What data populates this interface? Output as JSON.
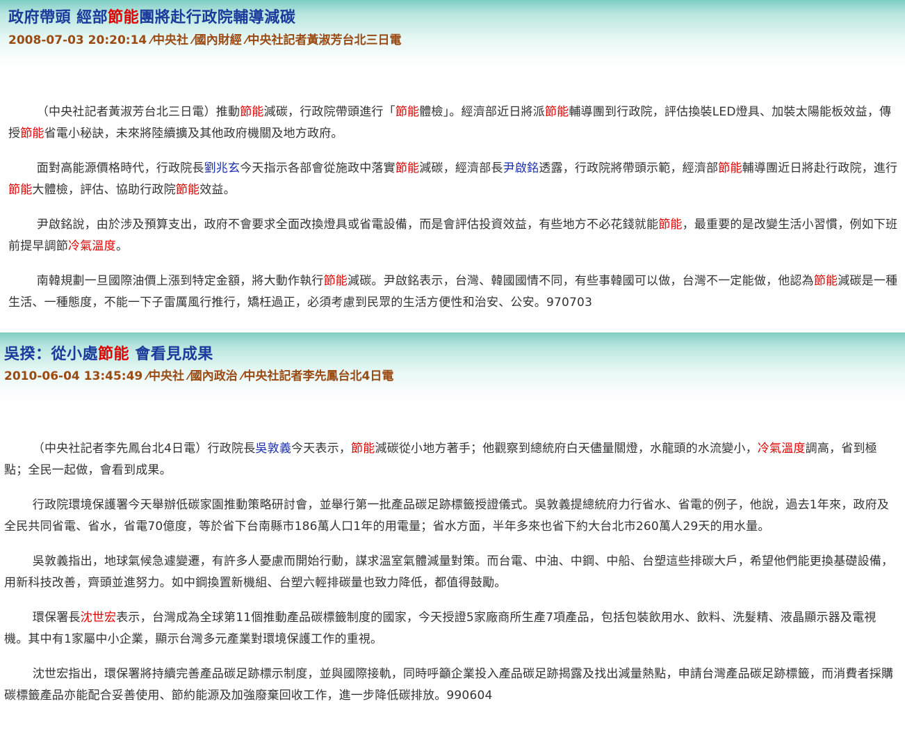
{
  "articles": [
    {
      "title": {
        "pre": "政府帶頭 經部",
        "hl": "節能",
        "post": "團將赴行政院輔導減碳"
      },
      "meta": "2008-07-03 20:20:14 ⁄中央社 ⁄國內財經 ⁄中央社記者黃淑芳台北三日電",
      "paragraphs": [
        [
          {
            "t": "（中央社記者黃淑芳台北三日電）推動"
          },
          {
            "t": "節能",
            "s": "kw"
          },
          {
            "t": "減碳，行政院帶頭進行「"
          },
          {
            "t": "節能",
            "s": "kw"
          },
          {
            "t": "體檢」。經濟部近日將派"
          },
          {
            "t": "節能",
            "s": "kw"
          },
          {
            "t": "輔導團到行政院，評估換裝LED燈具、加裝太陽能板效益，傳授"
          },
          {
            "t": "節能",
            "s": "kw"
          },
          {
            "t": "省電小秘訣，未來將陸續擴及其他政府機關及地方政府。"
          }
        ],
        [
          {
            "t": "面對高能源價格時代，行政院長"
          },
          {
            "t": "劉兆玄",
            "s": "nm"
          },
          {
            "t": "今天指示各部會從施政中落實"
          },
          {
            "t": "節能",
            "s": "kw"
          },
          {
            "t": "減碳，經濟部長"
          },
          {
            "t": "尹啟銘",
            "s": "nm"
          },
          {
            "t": "透露，行政院將帶頭示範，經濟部"
          },
          {
            "t": "節能",
            "s": "kw"
          },
          {
            "t": "輔導團近日將赴行政院，進行"
          },
          {
            "t": "節能",
            "s": "kw"
          },
          {
            "t": "大體檢，評估、協助行政院"
          },
          {
            "t": "節能",
            "s": "kw"
          },
          {
            "t": "效益。"
          }
        ],
        [
          {
            "t": "尹啟銘說，由於涉及預算支出，政府不會要求全面改換燈具或省電設備，而是會評估投資效益，有些地方不必花錢就能"
          },
          {
            "t": "節能",
            "s": "kw"
          },
          {
            "t": "，最重要的是改變生活小習慣，例如下班前提早調節"
          },
          {
            "t": "冷氣溫度",
            "s": "kw"
          },
          {
            "t": "。"
          }
        ],
        [
          {
            "t": "南韓規劃一旦國際油價上漲到特定金額，將大動作執行"
          },
          {
            "t": "節能",
            "s": "kw"
          },
          {
            "t": "減碳。尹啟銘表示，台灣、韓國國情不同，有些事韓國可以做，台灣不一定能做，他認為"
          },
          {
            "t": "節能",
            "s": "kw"
          },
          {
            "t": "減碳是一種生活、一種態度，不能一下子雷厲風行推行，矯枉過正，必須考慮到民眾的生活方便性和治安、公安。970703"
          }
        ]
      ]
    },
    {
      "title": {
        "pre": "吳揆：從小處",
        "hl": "節能",
        "post": " 會看見成果"
      },
      "meta": "2010-06-04 13:45:49 ⁄中央社 ⁄國內政治 ⁄中央社記者李先鳳台北4日電",
      "paragraphs": [
        [
          {
            "t": "（中央社記者李先鳳台北4日電）行政院長"
          },
          {
            "t": "吳敦義",
            "s": "nm"
          },
          {
            "t": "今天表示，"
          },
          {
            "t": "節能",
            "s": "kw"
          },
          {
            "t": "減碳從小地方著手；他觀察到總統府白天儘量關燈，水龍頭的水流變小，"
          },
          {
            "t": "冷氣溫度",
            "s": "kw"
          },
          {
            "t": "調高，省到極點；全民一起做，會看到成果。"
          }
        ],
        [
          {
            "t": "行政院環境保護署今天舉辦低碳家園推動策略研討會，並舉行第一批產品碳足跡標籤授證儀式。吳敦義提總統府力行省水、省電的例子，他說，過去1年來，政府及全民共同省電、省水，省電70億度，等於省下台南縣市186萬人口1年的用電量；省水方面，半年多來也省下約大台北市260萬人29天的用水量。"
          }
        ],
        [
          {
            "t": "吳敦義指出，地球氣候急遽變遷，有許多人憂慮而開始行動，謀求溫室氣體減量對策。而台電、中油、中鋼、中船、台塑這些排碳大戶，希望他們能更換基礎設備，用新科技改善，齊頭並進努力。如中鋼換置新機組、台塑六輕排碳量也致力降低，都值得鼓勵。"
          }
        ],
        [
          {
            "t": "環保署長"
          },
          {
            "t": "沈世宏",
            "s": "kw"
          },
          {
            "t": "表示，台灣成為全球第11個推動產品碳標籤制度的國家，今天授證5家廠商所生產7項產品，包括包裝飲用水、飲料、洗髮精、液晶顯示器及電視機。其中有1家屬中小企業，顯示台灣多元產業對環境保護工作的重視。"
          }
        ],
        [
          {
            "t": "沈世宏指出，環保署將持續完善產品碳足跡標示制度，並與國際接軌，同時呼籲企業投入產品碳足跡揭露及找出減量熱點，申請台灣產品碳足跡標籤，而消費者採購碳標籤產品亦能配合妥善使用、節約能源及加強廢棄回收工作，進一步降低碳排放。990604"
          }
        ]
      ]
    }
  ]
}
